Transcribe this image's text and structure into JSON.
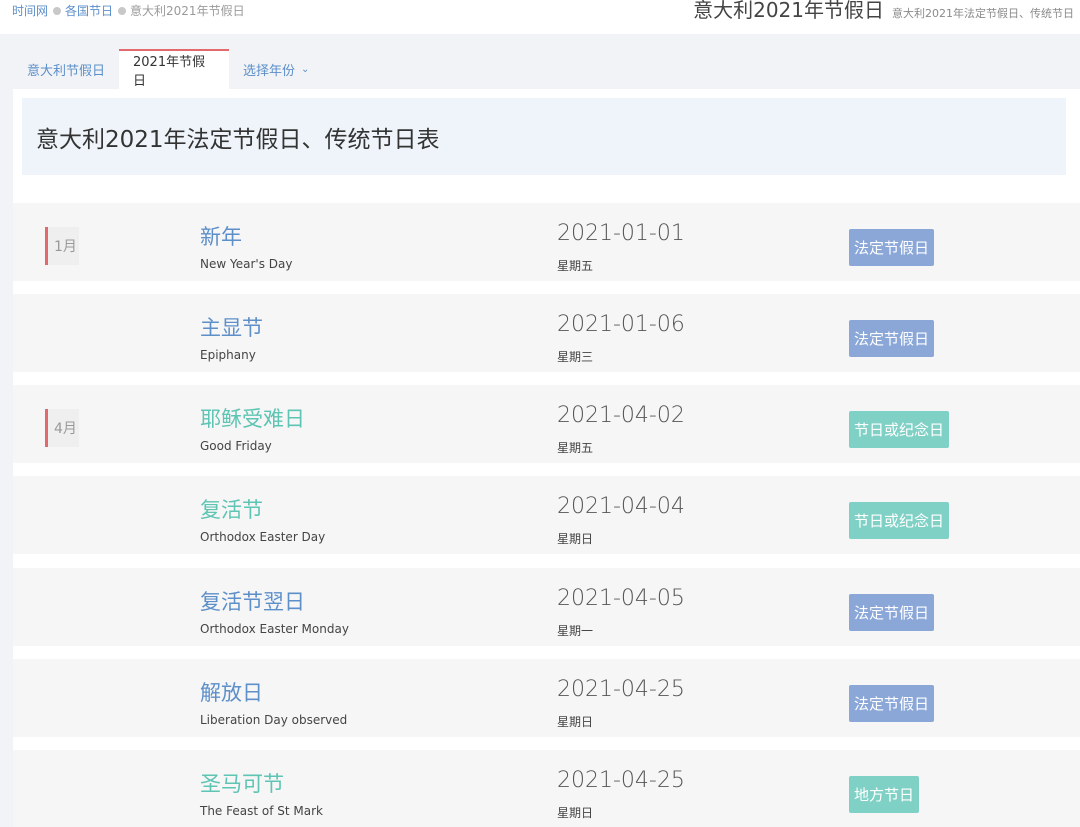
{
  "breadcrumb": {
    "home": "时间网",
    "section": "各国节日",
    "current": "意大利2021年节假日"
  },
  "header": {
    "title": "意大利2021年节假日",
    "subtitle": "意大利2021年法定节假日、传统节日"
  },
  "tabs": {
    "tab1": "意大利节假日",
    "tab2": "2021年节假日",
    "tab3": "选择年份"
  },
  "panel": {
    "heading": "意大利2021年法定节假日、传统节日表"
  },
  "colors": {
    "link_blue": "#5d8fc9",
    "accent_red": "#e2696d",
    "badge_blue": "#8aa7d8",
    "badge_teal": "#7fd1c6",
    "name_green": "#5ec4b3"
  },
  "holidays": [
    {
      "month": "1月",
      "name": "新年",
      "en": "New Year's Day",
      "date": "2021-01-01",
      "weekday": "星期五",
      "badge": "法定节假日"
    },
    {
      "month": "",
      "name": "主显节",
      "en": "Epiphany",
      "date": "2021-01-06",
      "weekday": "星期三",
      "badge": "法定节假日"
    },
    {
      "month": "4月",
      "name": "耶稣受难日",
      "en": "Good Friday",
      "date": "2021-04-02",
      "weekday": "星期五",
      "badge": "节日或纪念日"
    },
    {
      "month": "",
      "name": "复活节",
      "en": "Orthodox Easter Day",
      "date": "2021-04-04",
      "weekday": "星期日",
      "badge": "节日或纪念日"
    },
    {
      "month": "",
      "name": "复活节翌日",
      "en": "Orthodox Easter Monday",
      "date": "2021-04-05",
      "weekday": "星期一",
      "badge": "法定节假日"
    },
    {
      "month": "",
      "name": "解放日",
      "en": "Liberation Day observed",
      "date": "2021-04-25",
      "weekday": "星期日",
      "badge": "法定节假日"
    },
    {
      "month": "",
      "name": "圣马可节",
      "en": "The Feast of St Mark",
      "date": "2021-04-25",
      "weekday": "星期日",
      "badge": "地方节日"
    }
  ]
}
